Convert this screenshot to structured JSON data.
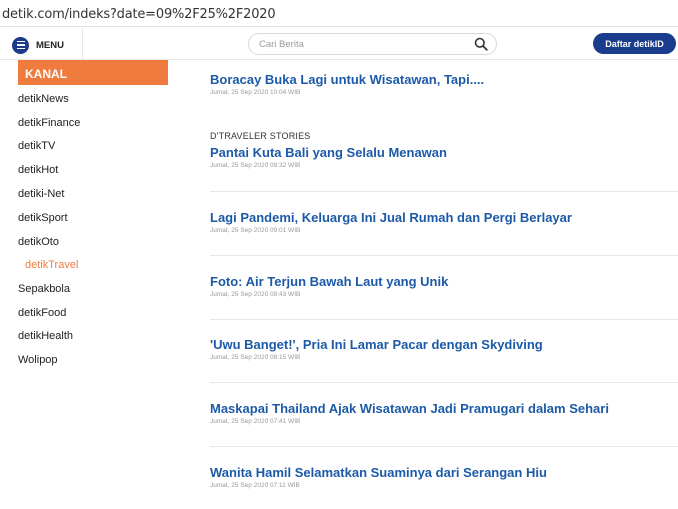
{
  "browser": {
    "url": "detik.com/indeks?date=09%2F25%2F2020"
  },
  "header": {
    "menu_label": "MENU",
    "search_placeholder": "Cari Berita",
    "register_button": "Daftar detikID"
  },
  "sidebar": {
    "heading": "KANAL",
    "items": [
      {
        "label": "detikNews"
      },
      {
        "label": "detikFinance"
      },
      {
        "label": "detikTV"
      },
      {
        "label": "detikHot"
      },
      {
        "label": "detiki-Net"
      },
      {
        "label": "detikSport"
      },
      {
        "label": "detikOto"
      },
      {
        "label": "detikTravel"
      },
      {
        "label": "Sepakbola"
      },
      {
        "label": "detikFood"
      },
      {
        "label": "detikHealth"
      },
      {
        "label": "Wolipop"
      }
    ]
  },
  "articles": [
    {
      "kicker": "",
      "title": "Boracay Buka Lagi untuk Wisatawan, Tapi....",
      "date": "Jumat, 25 Sep 2020 10:04 WIB"
    },
    {
      "kicker": "D'TRAVELER STORIES",
      "title": "Pantai Kuta Bali yang Selalu Menawan",
      "date": "Jumat, 25 Sep 2020 09:32 WIB"
    },
    {
      "kicker": "",
      "title": "Lagi Pandemi, Keluarga Ini Jual Rumah dan Pergi Berlayar",
      "date": "Jumat, 25 Sep 2020 09:01 WIB"
    },
    {
      "kicker": "",
      "title": "Foto: Air Terjun Bawah Laut yang Unik",
      "date": "Jumat, 25 Sep 2020 08:43 WIB"
    },
    {
      "kicker": "",
      "title": "'Uwu Banget!', Pria Ini Lamar Pacar dengan Skydiving",
      "date": "Jumat, 25 Sep 2020 08:15 WIB"
    },
    {
      "kicker": "",
      "title": "Maskapai Thailand Ajak Wisatawan Jadi Pramugari dalam Sehari",
      "date": "Jumat, 25 Sep 2020 07:41 WIB"
    },
    {
      "kicker": "",
      "title": "Wanita Hamil Selamatkan Suaminya dari Serangan Hiu",
      "date": "Jumat, 25 Sep 2020 07:11 WIB"
    }
  ]
}
